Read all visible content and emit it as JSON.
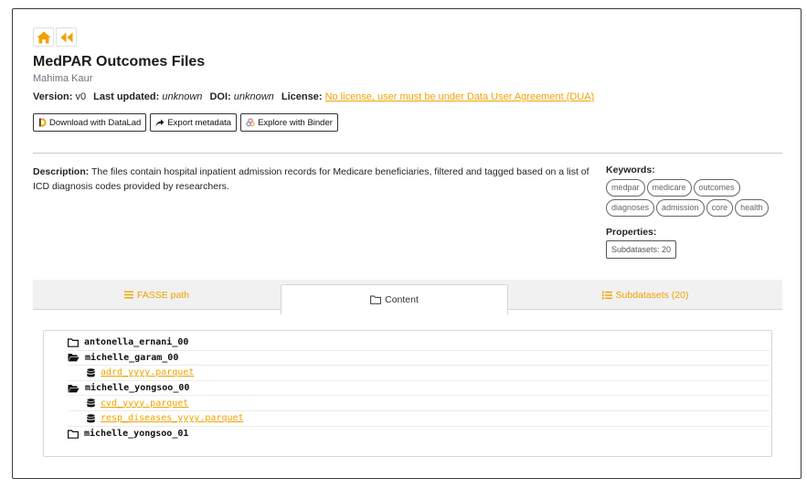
{
  "nav": {
    "home_icon": "home-icon",
    "back_icon": "backward-icon"
  },
  "dataset": {
    "title": "MedPAR Outcomes Files",
    "author": "Mahima Kaur"
  },
  "meta": {
    "version_label": "Version:",
    "version_value": "v0",
    "updated_label": "Last updated:",
    "updated_value": "unknown",
    "doi_label": "DOI:",
    "doi_value": "unknown",
    "license_label": "License:",
    "license_value": "No license, user must be under Data User Agreement (DUA)"
  },
  "buttons": {
    "download": "Download with DataLad",
    "export": "Export metadata",
    "binder": "Explore with Binder"
  },
  "description": {
    "label": "Description:",
    "text": "The files contain hospital inpatient admission records for Medicare beneficiaries, filtered and tagged based on a list of ICD diagnosis codes provided by researchers."
  },
  "keywords": {
    "label": "Keywords:",
    "items": [
      "medpar",
      "medicare",
      "outcomes",
      "diagnoses",
      "admission",
      "core",
      "health"
    ]
  },
  "properties": {
    "label": "Properties:",
    "subdatasets": "Subdatasets: 20"
  },
  "tabs": {
    "fasse": "FASSE path",
    "content": "Content",
    "subdatasets": "Subdatasets (20)"
  },
  "tree": {
    "rows": [
      {
        "type": "folder",
        "state": "closed",
        "name": "antonella_ernani_00"
      },
      {
        "type": "folder",
        "state": "open",
        "name": "michelle_garam_00"
      },
      {
        "type": "file",
        "name": "adrd_yyyy.parquet"
      },
      {
        "type": "folder",
        "state": "open",
        "name": "michelle_yongsoo_00"
      },
      {
        "type": "file",
        "name": "cvd_yyyy.parquet"
      },
      {
        "type": "file",
        "name": "resp_diseases_yyyy.parquet"
      },
      {
        "type": "folder",
        "state": "closed",
        "name": "michelle_yongsoo_01"
      }
    ]
  },
  "colors": {
    "accent": "#f0a202",
    "border": "#3a3a3a"
  }
}
